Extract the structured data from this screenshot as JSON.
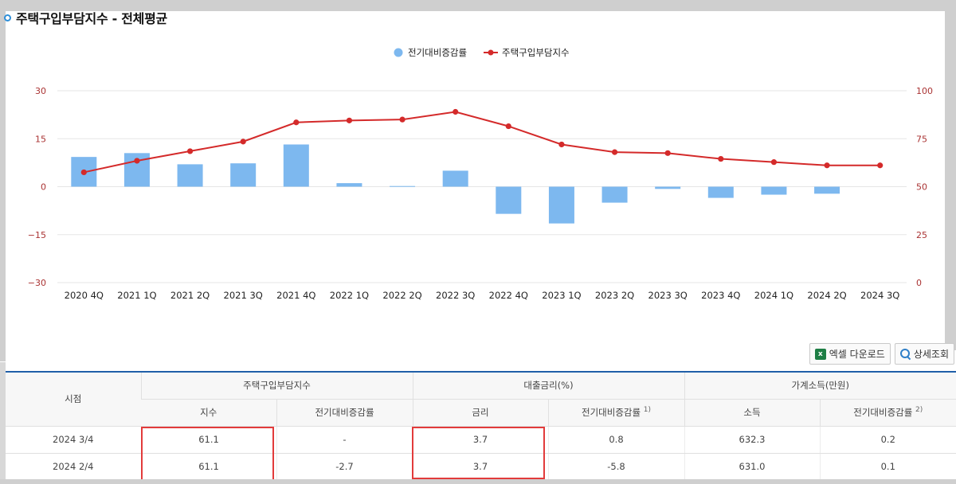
{
  "title": "주택구입부담지수 - 전체평균",
  "chart_data": {
    "type": "bar+line",
    "categories": [
      "2020 4Q",
      "2021 1Q",
      "2021 2Q",
      "2021 3Q",
      "2021 4Q",
      "2022 1Q",
      "2022 2Q",
      "2022 3Q",
      "2022 4Q",
      "2023 1Q",
      "2023 2Q",
      "2023 3Q",
      "2023 4Q",
      "2024 1Q",
      "2024 2Q",
      "2024 3Q"
    ],
    "series": [
      {
        "name": "전기대비증감률",
        "type": "bar",
        "axis": "left",
        "color": "#7db8ef",
        "values": [
          9.3,
          10.5,
          7.0,
          7.3,
          13.2,
          1.1,
          0.2,
          5.0,
          -8.5,
          -11.5,
          -5.0,
          -0.7,
          -3.5,
          -2.5,
          -2.2,
          0
        ]
      },
      {
        "name": "주택구입부담지수",
        "type": "line",
        "axis": "right",
        "color": "#d42a2a",
        "values": [
          57.5,
          63.5,
          68.5,
          73.5,
          83.5,
          84.5,
          85,
          89,
          81.5,
          72,
          68,
          67.5,
          64.5,
          62.8,
          61.1,
          61.1
        ]
      }
    ],
    "y_left": {
      "min": -30,
      "max": 30,
      "ticks": [
        30,
        15,
        0,
        -15,
        -30
      ],
      "tick_labels": [
        "30",
        "15",
        "0",
        "−15",
        "−30"
      ]
    },
    "y_right": {
      "min": 0,
      "max": 100,
      "ticks": [
        100,
        75,
        50,
        25,
        0
      ],
      "tick_labels": [
        "100",
        "75",
        "50",
        "25",
        "0"
      ]
    },
    "legend": {
      "position": "top-center"
    },
    "grid": true
  },
  "buttons": {
    "excel": "엑셀 다운로드",
    "detail": "상세조회"
  },
  "table": {
    "col_period": "시점",
    "group1": "주택구입부담지수",
    "group2": "대출금리(%)",
    "group3": "가계소득(만원)",
    "sub": {
      "index": "지수",
      "change1": "전기대비증감률",
      "rate": "금리",
      "change2": "전기대비증감률",
      "change2_note": "1)",
      "income": "소득",
      "change3": "전기대비증감률",
      "change3_note": "2)"
    },
    "rows": [
      {
        "period": "2024 3/4",
        "index": "61.1",
        "change1": "-",
        "rate": "3.7",
        "change2": "0.8",
        "income": "632.3",
        "change3": "0.2"
      },
      {
        "period": "2024 2/4",
        "index": "61.1",
        "change1": "-2.7",
        "rate": "3.7",
        "change2": "-5.8",
        "income": "631.0",
        "change3": "0.1"
      }
    ]
  }
}
